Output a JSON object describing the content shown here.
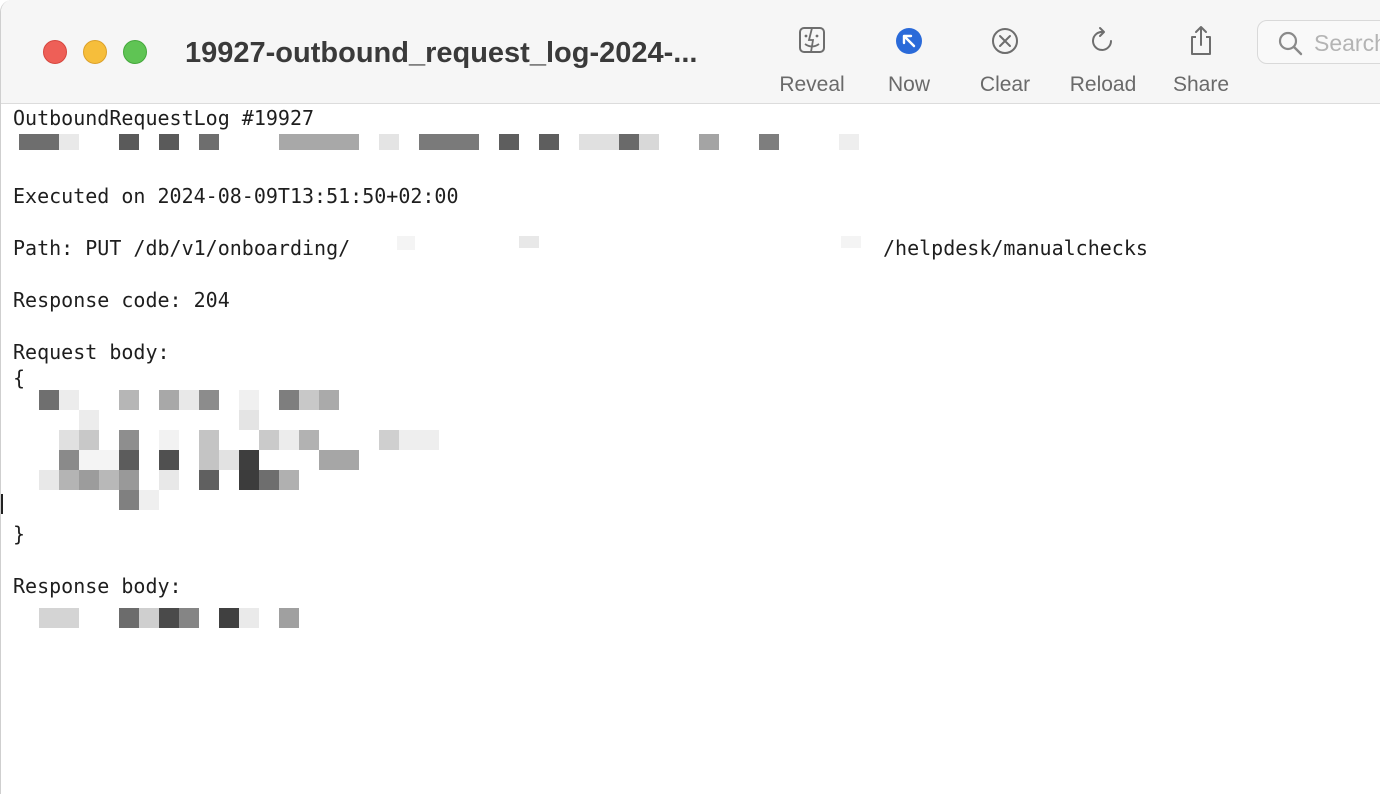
{
  "window": {
    "title": "19927-outbound_request_log-2024-...",
    "traffic_lights": {
      "close": "#ee5f57",
      "minimize": "#f6be3b",
      "zoom": "#5fc454"
    }
  },
  "toolbar": {
    "buttons": [
      {
        "label": "Reveal",
        "icon": "finder-icon"
      },
      {
        "label": "Now",
        "icon": "arrow-up-left-circle-icon"
      },
      {
        "label": "Clear",
        "icon": "xmark-circle-icon"
      },
      {
        "label": "Reload",
        "icon": "reload-icon"
      },
      {
        "label": "Share",
        "icon": "share-icon"
      }
    ],
    "accent": "#2a6ad9",
    "search_placeholder": "Search"
  },
  "log": {
    "header": "OutboundRequestLog #19927",
    "executed": "Executed on 2024-08-09T13:51:50+02:00",
    "path_prefix": "Path: PUT /db/v1/onboarding/",
    "path_suffix": "/helpdesk/manualchecks",
    "response_code": "Response code: 204",
    "request_body_label": "Request body:",
    "open_brace": "{",
    "close_brace": "}",
    "response_body_label": "Response body:"
  }
}
